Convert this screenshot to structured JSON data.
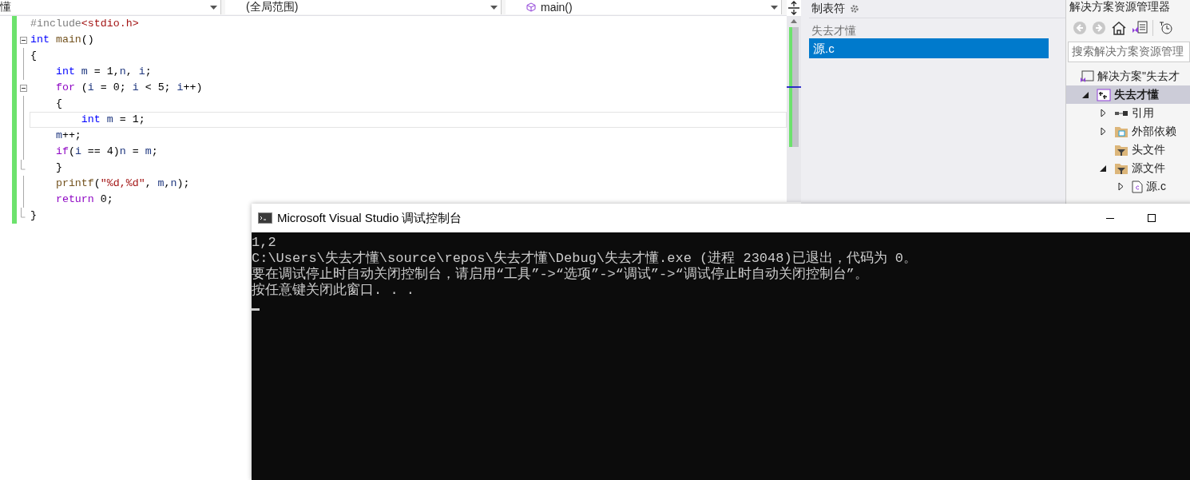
{
  "nav_bar": {
    "dropdowns": [
      {
        "label": "懂",
        "kind": "plain"
      },
      {
        "label": "(全局范围)",
        "kind": "plain"
      },
      {
        "label": "main()",
        "kind": "function"
      }
    ]
  },
  "editor": {
    "lines": [
      {
        "current": false,
        "fold_toggle": false,
        "block_end": false,
        "tokens": [
          {
            "kind": "preproc",
            "text": "#include"
          },
          {
            "kind": "string",
            "text": "<stdio.h>"
          }
        ]
      },
      {
        "current": false,
        "fold_toggle": true,
        "block_end": false,
        "tokens": [
          {
            "kind": "type",
            "text": "int"
          },
          {
            "kind": "func",
            "text": " main"
          },
          {
            "kind": "plain",
            "text": "()"
          }
        ]
      },
      {
        "current": false,
        "fold_toggle": false,
        "block_end": false,
        "tokens": [
          {
            "kind": "plain",
            "text": "{"
          }
        ]
      },
      {
        "current": false,
        "fold_toggle": false,
        "block_end": false,
        "tokens": [
          {
            "kind": "type",
            "text": "    int"
          },
          {
            "kind": "var",
            "text": " m"
          },
          {
            "kind": "plain",
            "text": " = 1,"
          },
          {
            "kind": "var",
            "text": "n"
          },
          {
            "kind": "plain",
            "text": ","
          },
          {
            "kind": "var",
            "text": " i"
          },
          {
            "kind": "plain",
            "text": ";"
          }
        ]
      },
      {
        "current": false,
        "fold_toggle": true,
        "block_end": false,
        "tokens": [
          {
            "kind": "control",
            "text": "    for"
          },
          {
            "kind": "plain",
            "text": " ("
          },
          {
            "kind": "var",
            "text": "i"
          },
          {
            "kind": "plain",
            "text": " = 0; "
          },
          {
            "kind": "var",
            "text": "i"
          },
          {
            "kind": "plain",
            "text": " < 5; "
          },
          {
            "kind": "var",
            "text": "i"
          },
          {
            "kind": "plain",
            "text": "++)"
          }
        ]
      },
      {
        "current": false,
        "fold_toggle": false,
        "block_end": false,
        "tokens": [
          {
            "kind": "plain",
            "text": "    {"
          }
        ]
      },
      {
        "current": true,
        "fold_toggle": false,
        "block_end": false,
        "tokens": [
          {
            "kind": "type",
            "text": "        int"
          },
          {
            "kind": "var",
            "text": " m"
          },
          {
            "kind": "plain",
            "text": " = 1;"
          }
        ]
      },
      {
        "current": false,
        "fold_toggle": false,
        "block_end": false,
        "tokens": [
          {
            "kind": "var",
            "text": "    m"
          },
          {
            "kind": "plain",
            "text": "++;"
          }
        ]
      },
      {
        "current": false,
        "fold_toggle": false,
        "block_end": false,
        "tokens": [
          {
            "kind": "control",
            "text": "    if"
          },
          {
            "kind": "plain",
            "text": "("
          },
          {
            "kind": "var",
            "text": "i"
          },
          {
            "kind": "plain",
            "text": " == 4)"
          },
          {
            "kind": "var",
            "text": "n"
          },
          {
            "kind": "plain",
            "text": " = "
          },
          {
            "kind": "var",
            "text": "m"
          },
          {
            "kind": "plain",
            "text": ";"
          }
        ]
      },
      {
        "current": false,
        "fold_toggle": false,
        "block_end": true,
        "tokens": [
          {
            "kind": "plain",
            "text": "    }"
          }
        ]
      },
      {
        "current": false,
        "fold_toggle": false,
        "block_end": false,
        "tokens": [
          {
            "kind": "func",
            "text": "    printf"
          },
          {
            "kind": "plain",
            "text": "("
          },
          {
            "kind": "string",
            "text": "\"%d,%d\""
          },
          {
            "kind": "plain",
            "text": ", "
          },
          {
            "kind": "var",
            "text": "m"
          },
          {
            "kind": "plain",
            "text": ","
          },
          {
            "kind": "var",
            "text": "n"
          },
          {
            "kind": "plain",
            "text": ");"
          }
        ]
      },
      {
        "current": false,
        "fold_toggle": false,
        "block_end": false,
        "tokens": [
          {
            "kind": "control",
            "text": "    return"
          },
          {
            "kind": "plain",
            "text": " 0;"
          }
        ]
      },
      {
        "current": false,
        "fold_toggle": false,
        "block_end": true,
        "tokens": [
          {
            "kind": "plain",
            "text": "}"
          }
        ]
      }
    ]
  },
  "tab_panel": {
    "title": "制表符",
    "groups": [
      {
        "label": "失去才懂",
        "items": [
          {
            "label": "源.c",
            "selected": true
          }
        ]
      }
    ]
  },
  "solution_explorer": {
    "title": "解决方案资源管理器",
    "search": {
      "placeholder": "搜索解决方案资源管理"
    },
    "tree": [
      {
        "label": "解决方案\"失去才",
        "kind": "solution",
        "selected": false,
        "children": [
          {
            "label": "失去才懂",
            "kind": "project",
            "selected": true,
            "expanded": true,
            "children": [
              {
                "label": "引用",
                "kind": "references",
                "selected": false,
                "expanded": false
              },
              {
                "label": "外部依赖",
                "kind": "external",
                "selected": false,
                "expanded": false
              },
              {
                "label": "头文件",
                "kind": "filter",
                "selected": false
              },
              {
                "label": "源文件",
                "kind": "filter",
                "selected": false,
                "expanded": true,
                "children": [
                  {
                    "label": "源.c",
                    "kind": "file",
                    "selected": false,
                    "expanded": false
                  }
                ]
              }
            ]
          }
        ]
      }
    ]
  },
  "console": {
    "title": "Microsoft Visual Studio 调试控制台",
    "lines": [
      "1,2",
      "C:\\Users\\失去才懂\\source\\repos\\失去才懂\\Debug\\失去才懂.exe (进程 23048)已退出，代码为 0。",
      "要在调试停止时自动关闭控制台，请启用“工具”->“选项”->“调试”->“调试停止时自动关闭控制台”。",
      "按任意键关闭此窗口. . ."
    ]
  }
}
